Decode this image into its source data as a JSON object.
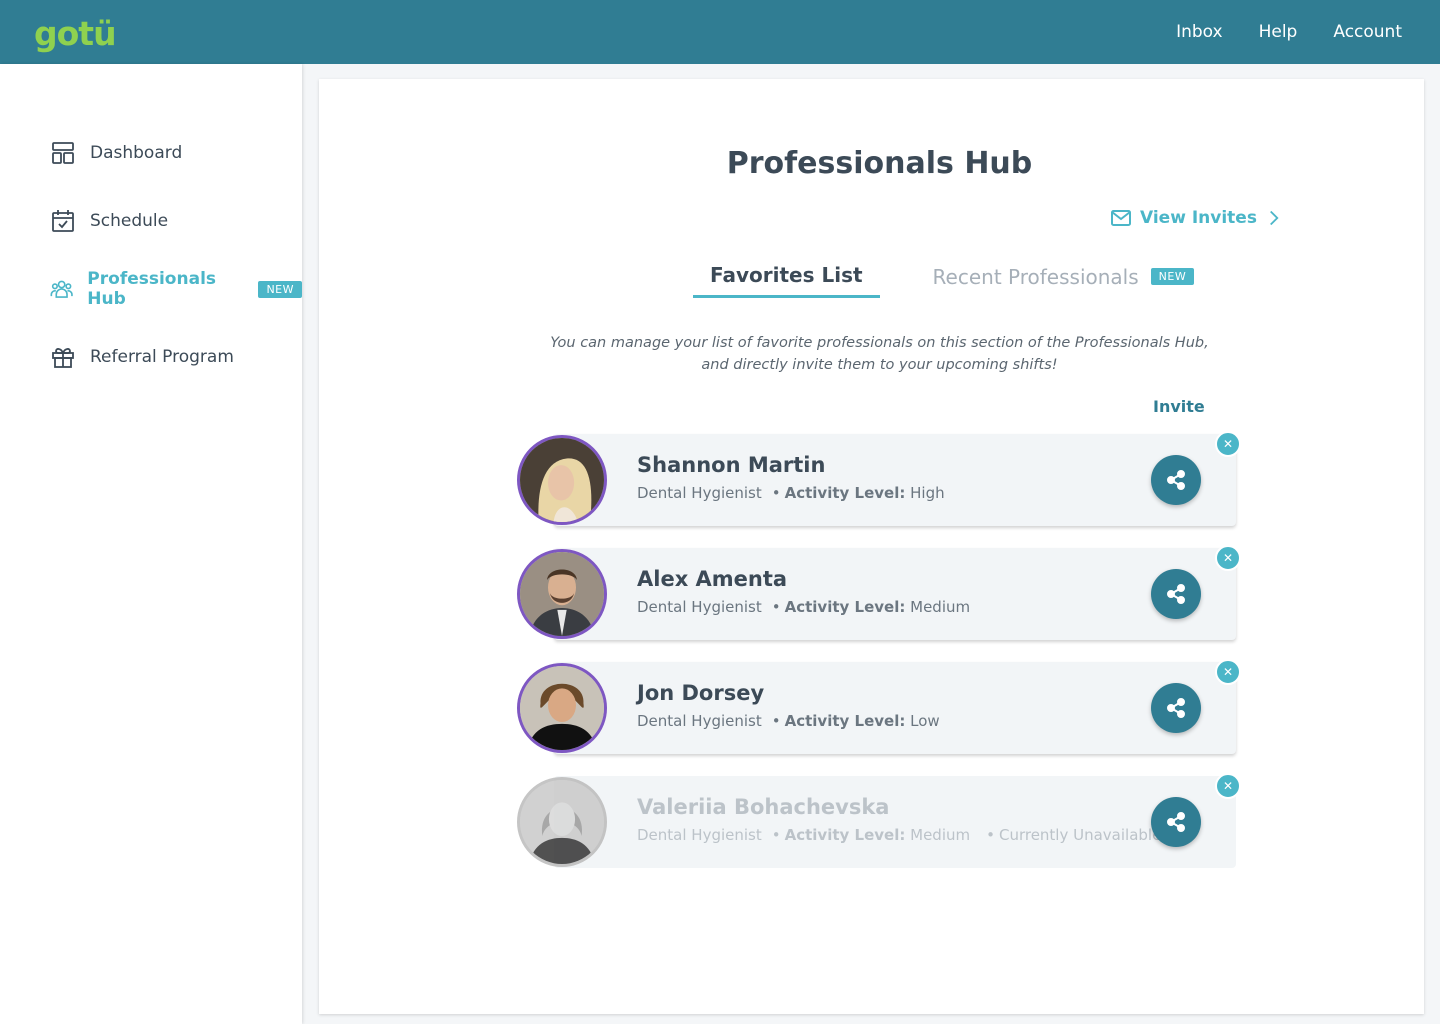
{
  "header": {
    "logo_text": "gotü",
    "nav": [
      "Inbox",
      "Help",
      "Account"
    ]
  },
  "sidebar": {
    "items": [
      {
        "label": "Dashboard",
        "icon": "dashboard-icon"
      },
      {
        "label": "Schedule",
        "icon": "calendar-icon"
      },
      {
        "label": "Professionals Hub",
        "icon": "users-icon",
        "badge": "NEW",
        "active": true
      },
      {
        "label": "Referral Program",
        "icon": "gift-icon"
      }
    ]
  },
  "main": {
    "title": "Professionals Hub",
    "view_invites": "View Invites",
    "tabs": [
      {
        "label": "Favorites List",
        "active": true
      },
      {
        "label": "Recent Professionals",
        "badge": "NEW"
      }
    ],
    "description_line1": "You can manage your list of favorite professionals on this section of the Professionals Hub,",
    "description_line2": "and directly invite them to your upcoming shifts!",
    "invite_header": "Invite",
    "activity_label": "Activity Level:",
    "professionals": [
      {
        "name": "Shannon Martin",
        "role": "Dental Hygienist",
        "activity": "High"
      },
      {
        "name": "Alex Amenta",
        "role": "Dental Hygienist",
        "activity": "Medium"
      },
      {
        "name": "Jon Dorsey",
        "role": "Dental Hygienist",
        "activity": "Low"
      },
      {
        "name": "Valeriia Bohachevska",
        "role": "Dental Hygienist",
        "activity": "Medium",
        "status": "Currently Unavailable",
        "unavailable": true
      }
    ]
  },
  "colors": {
    "brand_teal": "#307d93",
    "accent_cyan": "#4bb6c8",
    "logo_green": "#8fd14f",
    "avatar_ring": "#7e57c2"
  }
}
